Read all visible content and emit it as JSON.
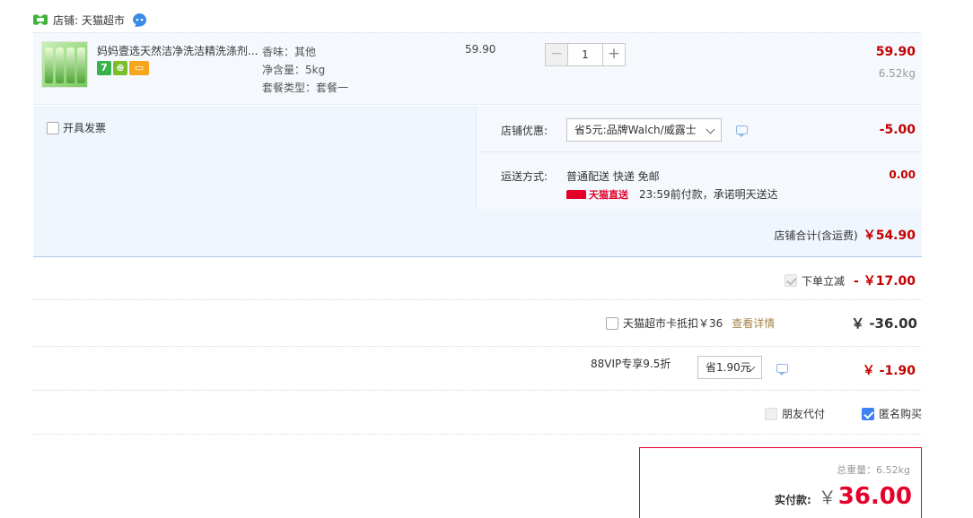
{
  "shop": {
    "label": "店铺: 天猫超市"
  },
  "item": {
    "title": "妈妈壹选天然洁净洗洁精洗涤剂...",
    "tags": [
      "7",
      "⊕",
      "▭"
    ],
    "sku": [
      "香味：其他",
      "净含量：5kg",
      "套餐类型：套餐一"
    ],
    "unit_price": "59.90",
    "qty": "1",
    "qty_minus": "−",
    "qty_plus": "+",
    "total": "59.90",
    "weight": "6.52kg"
  },
  "invoice": {
    "label": "开具发票"
  },
  "shop_discount": {
    "label": "店铺优惠:",
    "selected": "省5元:品牌Walch/威露士",
    "amount": "-5.00"
  },
  "shipping": {
    "label": "运送方式:",
    "method": "普通配送 快递 免邮",
    "tmall_logo": "天猫直送",
    "promise": "23:59前付款，承诺明天送达",
    "amount": "0.00"
  },
  "shop_total": {
    "label": "店铺合计(含运费)",
    "value": "￥54.90"
  },
  "order_discount": {
    "label": "下单立减",
    "value": "- ￥17.00"
  },
  "card": {
    "label": "天猫超市卡抵扣￥36",
    "link": "查看详情",
    "value": "￥ -36.00"
  },
  "vip": {
    "label": "88VIP专享9.5折",
    "selected": "省1.90元",
    "value": "￥ -1.90"
  },
  "friend": {
    "label": "朋友代付"
  },
  "anon": {
    "label": "匿名购买"
  },
  "pay": {
    "weight_label": "总重量：6.52kg",
    "label": "实付款:",
    "yen": "￥",
    "amount": "36.00"
  },
  "colors": {
    "price_red": "#c40000",
    "accent_blue": "#3d82f0",
    "tmall_red": "#e4002b"
  }
}
